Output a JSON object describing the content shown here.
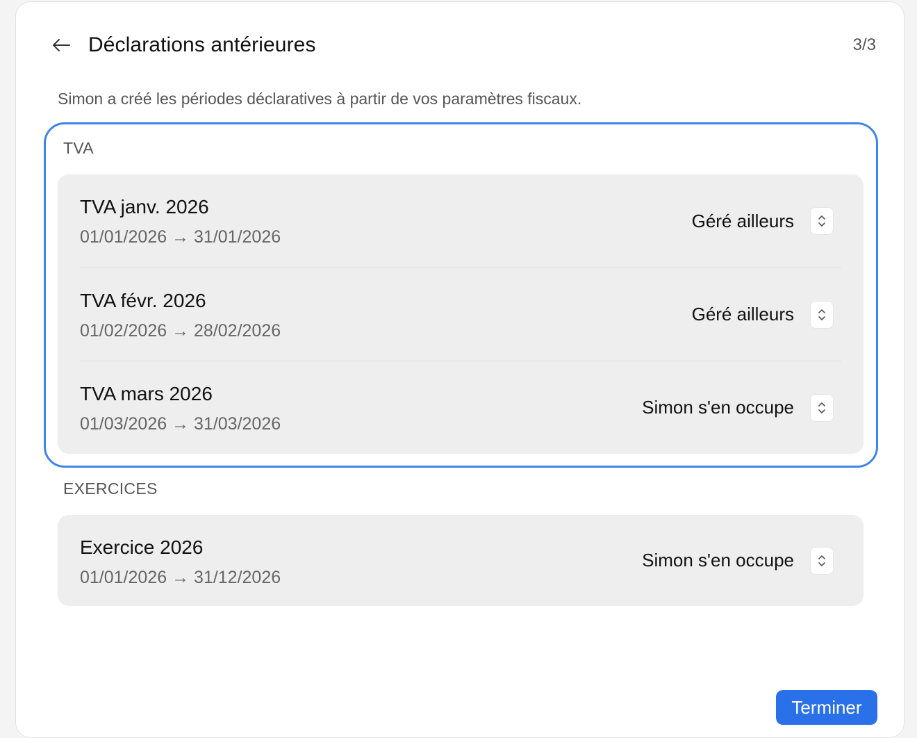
{
  "header": {
    "title": "Déclarations antérieures",
    "step": "3/3",
    "back_icon": "arrow-left-icon"
  },
  "intro": "Simon a créé les périodes déclaratives à partir de vos paramètres fiscaux.",
  "tva": {
    "label": "TVA",
    "rows": [
      {
        "title": "TVA janv. 2026",
        "dates": "01/01/2026 → 31/01/2026",
        "status": "Géré ailleurs"
      },
      {
        "title": "TVA févr. 2026",
        "dates": "01/02/2026 → 28/02/2026",
        "status": "Géré ailleurs"
      },
      {
        "title": "TVA mars 2026",
        "dates": "01/03/2026 → 31/03/2026",
        "status": "Simon s'en occupe"
      }
    ]
  },
  "exercices": {
    "label": "EXERCICES",
    "rows": [
      {
        "title": "Exercice 2026",
        "dates": "01/01/2026 → 31/12/2026",
        "status": "Simon s'en occupe"
      }
    ]
  },
  "footer": {
    "finish_label": "Terminer"
  },
  "colors": {
    "accent": "#2a70e8",
    "focus_ring": "#3f84ea",
    "card_bg": "#eeeeee"
  }
}
